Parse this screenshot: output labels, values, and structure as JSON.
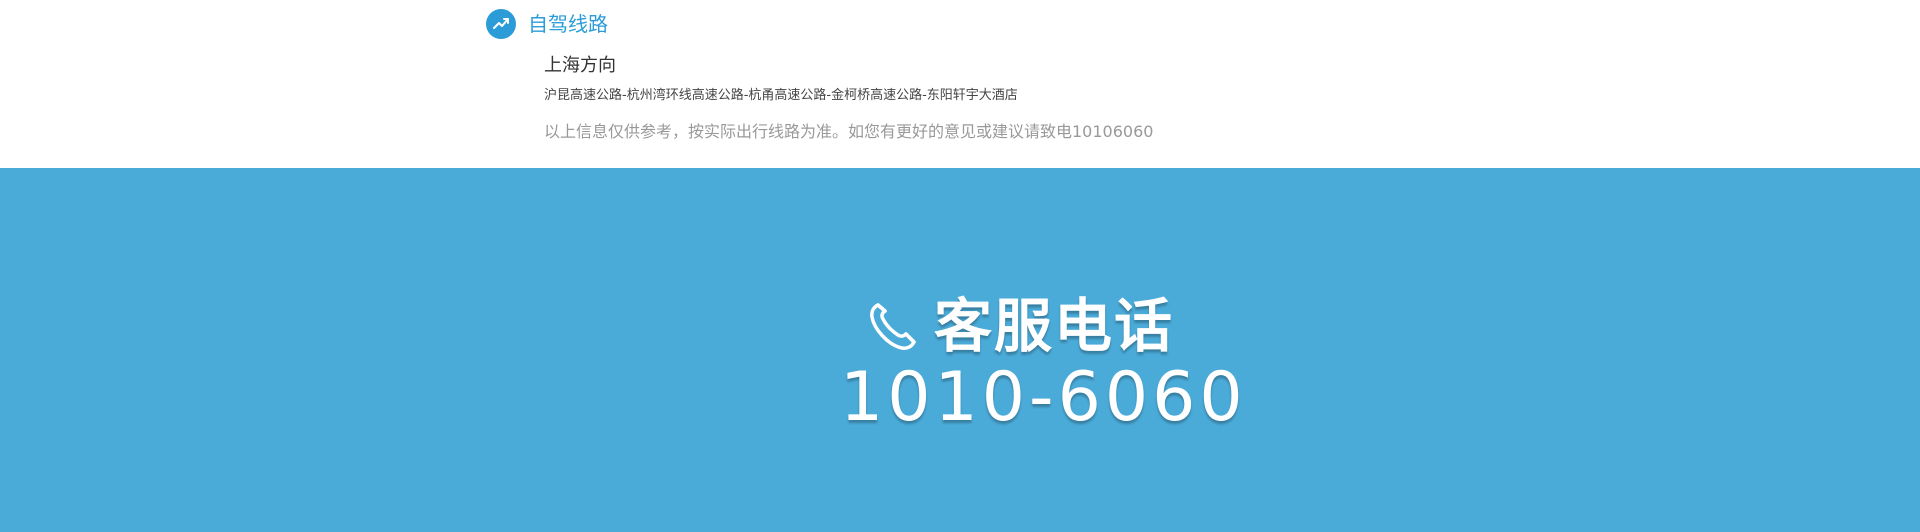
{
  "route": {
    "icon": "route-check-icon",
    "title": "自驾线路",
    "direction": "上海方向",
    "path": "沪昆高速公路-杭州湾环线高速公路-杭甬高速公路-金柯桥高速公路-东阳轩宇大酒店",
    "note": "以上信息仅供参考，按实际出行线路为准。如您有更好的意见或建议请致电10106060"
  },
  "hotline": {
    "icon": "phone-icon",
    "label": "客服电话",
    "number": "1010-6060"
  },
  "colors": {
    "accent": "#2b9cd8",
    "banner_background": "#4aaad8",
    "note_text": "#999999"
  }
}
